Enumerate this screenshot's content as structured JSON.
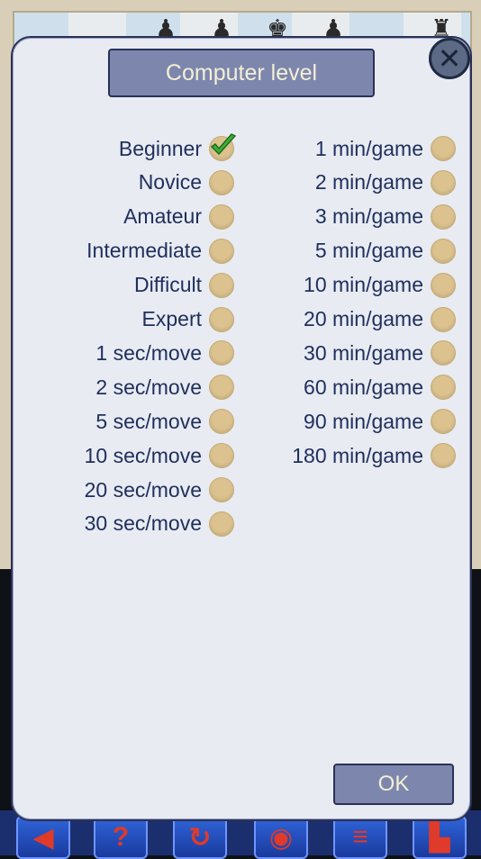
{
  "dialog": {
    "title": "Computer level",
    "ok_label": "OK",
    "close_icon": "close-icon"
  },
  "left_options": [
    {
      "label": "Beginner",
      "selected": true
    },
    {
      "label": "Novice",
      "selected": false
    },
    {
      "label": "Amateur",
      "selected": false
    },
    {
      "label": "Intermediate",
      "selected": false
    },
    {
      "label": "Difficult",
      "selected": false
    },
    {
      "label": "Expert",
      "selected": false
    },
    {
      "label": "1 sec/move",
      "selected": false
    },
    {
      "label": "2 sec/move",
      "selected": false
    },
    {
      "label": "5 sec/move",
      "selected": false
    },
    {
      "label": "10 sec/move",
      "selected": false
    },
    {
      "label": "20 sec/move",
      "selected": false
    },
    {
      "label": "30 sec/move",
      "selected": false
    }
  ],
  "right_options": [
    {
      "label": "1 min/game",
      "selected": false
    },
    {
      "label": "2 min/game",
      "selected": false
    },
    {
      "label": "3 min/game",
      "selected": false
    },
    {
      "label": "5 min/game",
      "selected": false
    },
    {
      "label": "10 min/game",
      "selected": false
    },
    {
      "label": "20 min/game",
      "selected": false
    },
    {
      "label": "30 min/game",
      "selected": false
    },
    {
      "label": "60 min/game",
      "selected": false
    },
    {
      "label": "90 min/game",
      "selected": false
    },
    {
      "label": "180 min/game",
      "selected": false
    }
  ],
  "toolbar": {
    "icons": [
      "back-icon",
      "help-icon",
      "rotate-icon",
      "eye-icon",
      "menu-icon",
      "castle-icon"
    ]
  },
  "colors": {
    "dialog_bg": "#e8ebf2",
    "button_bg": "#7d87ad",
    "button_text": "#f3efd6",
    "label_text": "#1f2f5c",
    "radio_fill": "#dbc28f",
    "check_green": "#3fae3a"
  }
}
